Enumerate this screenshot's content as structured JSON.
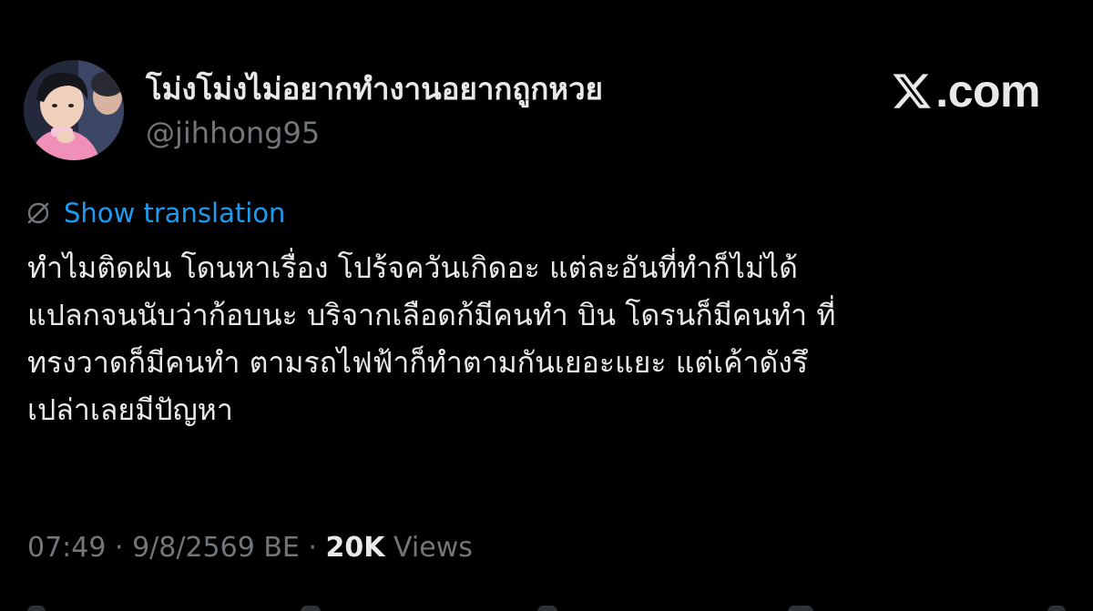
{
  "author": {
    "display_name": "โม่งโม่งไม่อยากทำงานอยากถูกหวย",
    "handle": "@jihhong95",
    "avatar_icon": "avatar-photo"
  },
  "brand": {
    "label": ".com",
    "logo_icon": "x-logo-icon"
  },
  "translation": {
    "icon": "globe-icon",
    "label": "Show translation"
  },
  "tweet": {
    "lines": [
      "ทำไมติดฝน โดนหาเรื่อง โปร้จควันเกิดอะ แต่ละอันที่ทำก็ไม่ได้",
      "แปลกจนนับว่าก้อบนะ บริจากเลือดก้มีคนทำ บิน โดรนก็มีคนทำ ที่",
      "ทรงวาดก็มีคนทำ ตามรถไฟฟ้าก็ทำตามกันเยอะแยะ แต่เค้าดังรึ",
      "เปล่าเลยมีปัญหา"
    ]
  },
  "meta": {
    "time": "07:49",
    "separator": " · ",
    "date": "9/8/2569 BE",
    "views_count": "20K",
    "views_label": " Views"
  },
  "colors": {
    "background": "#000000",
    "text_primary": "#e7e9ea",
    "text_secondary": "#71767b",
    "link": "#1d9bf0"
  }
}
